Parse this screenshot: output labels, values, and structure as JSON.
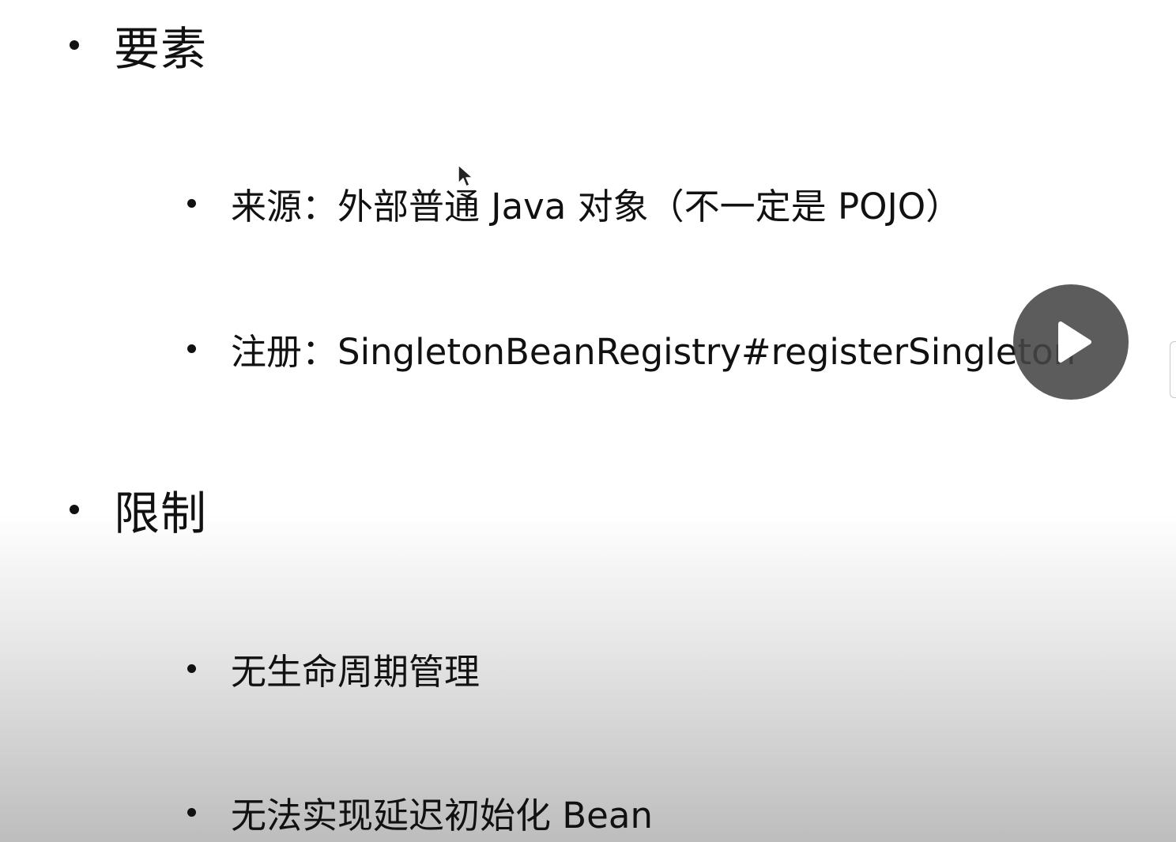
{
  "slide": {
    "sections": [
      {
        "heading": "要素",
        "items": [
          "来源：外部普通 Java 对象（不一定是 POJO）",
          "注册：SingletonBeanRegistry#registerSingleton"
        ]
      },
      {
        "heading": "限制",
        "items": [
          "无生命周期管理",
          "无法实现延迟初始化 Bean"
        ]
      }
    ]
  },
  "overlay": {
    "play_icon": "play-icon",
    "cursor_icon": "mouse-cursor-icon"
  }
}
